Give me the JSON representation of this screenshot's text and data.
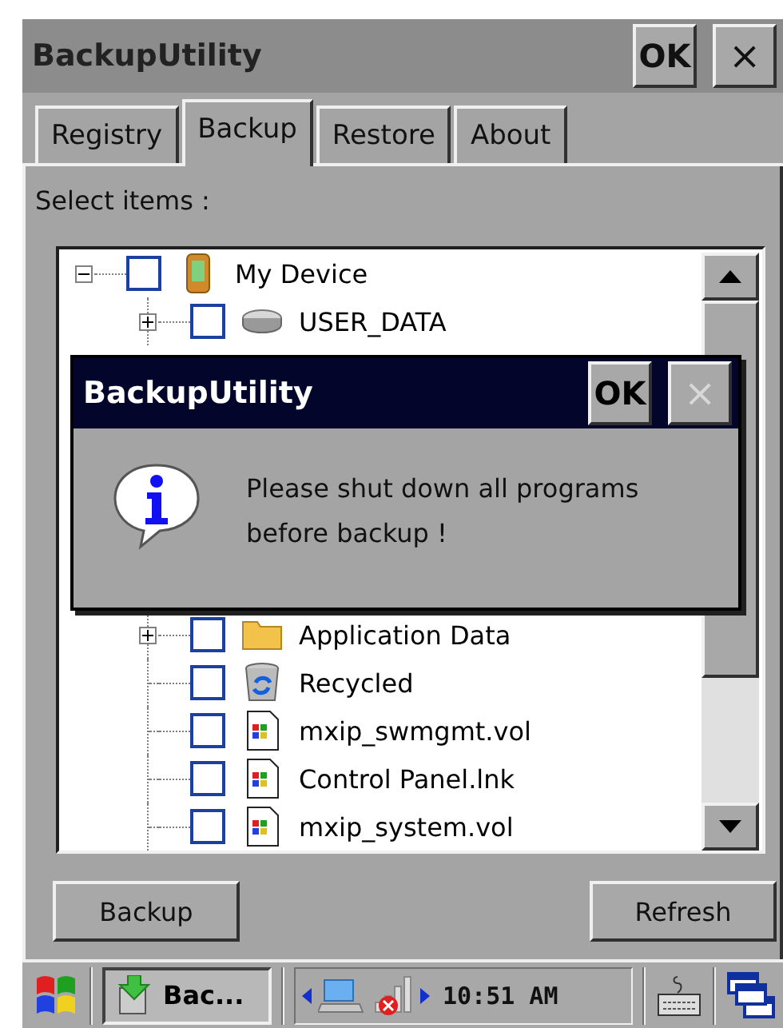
{
  "window": {
    "title": "BackupUtility",
    "ok": "OK",
    "close": "×"
  },
  "tabs": [
    {
      "label": "Registry",
      "selected": false
    },
    {
      "label": "Backup",
      "selected": true
    },
    {
      "label": "Restore",
      "selected": false
    },
    {
      "label": "About",
      "selected": false
    }
  ],
  "select_label": "Select items :",
  "tree": [
    {
      "label": "My Device",
      "kind": "device",
      "expanded": true,
      "checked": false,
      "children": [
        {
          "label": "USER_DATA",
          "kind": "drive",
          "expanded": false,
          "checked": false
        },
        {
          "label": "Application Data",
          "kind": "folder",
          "expanded": false,
          "checked": false
        },
        {
          "label": "Recycled",
          "kind": "recycle",
          "checked": false
        },
        {
          "label": "mxip_swmgmt.vol",
          "kind": "file",
          "checked": false
        },
        {
          "label": "Control Panel.lnk",
          "kind": "file",
          "checked": false
        },
        {
          "label": "mxip_system.vol",
          "kind": "file",
          "checked": false
        }
      ]
    }
  ],
  "buttons": [
    "Backup",
    "Refresh"
  ],
  "dialog": {
    "title": "BackupUtility",
    "ok": "OK",
    "close": "×",
    "close_disabled": true,
    "message": "Please shut down all programs before backup !"
  },
  "taskbar": {
    "task": "Bac...",
    "clock": "10:51 AM"
  }
}
